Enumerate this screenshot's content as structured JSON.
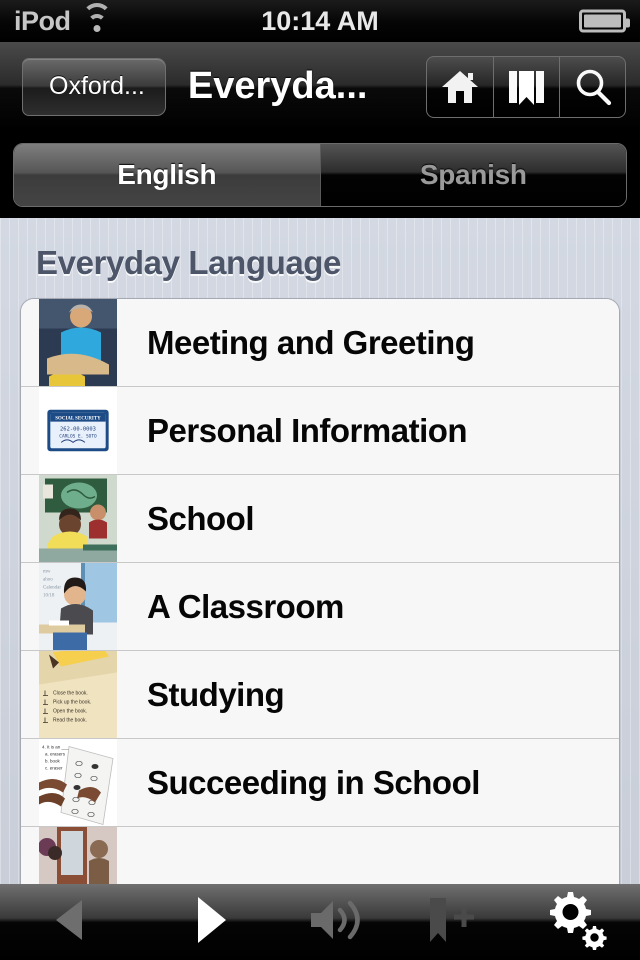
{
  "status_bar": {
    "carrier": "iPod",
    "wifi_icon": "wifi-icon",
    "time": "10:14 AM",
    "battery_icon": "battery-icon"
  },
  "nav_bar": {
    "back_label": "Oxford...",
    "title": "Everyda...",
    "buttons": [
      {
        "name": "home-button",
        "icon": "home-icon"
      },
      {
        "name": "bookmarks-button",
        "icon": "bookmarks-icon"
      },
      {
        "name": "search-button",
        "icon": "search-icon"
      }
    ]
  },
  "segmented_control": {
    "selected": "English",
    "segments": [
      {
        "label": "English",
        "selected": true
      },
      {
        "label": "Spanish",
        "selected": false
      }
    ]
  },
  "main": {
    "section_title": "Everyday Language",
    "rows": [
      {
        "label": "Meeting and Greeting",
        "thumb": "people-shaking-hands-photo"
      },
      {
        "label": "Personal Information",
        "thumb": "social-security-card-photo"
      },
      {
        "label": "School",
        "thumb": "student-raising-hand-photo"
      },
      {
        "label": "A Classroom",
        "thumb": "student-at-desk-photo"
      },
      {
        "label": "Studying",
        "thumb": "pencil-and-book-instructions-photo"
      },
      {
        "label": "Succeeding in School",
        "thumb": "multiple-choice-test-photo"
      },
      {
        "label": "",
        "thumb": "classroom-doorway-photo"
      }
    ]
  },
  "toolbar": {
    "buttons": [
      {
        "name": "previous-button",
        "icon": "previous-triangle-icon"
      },
      {
        "name": "play-button",
        "icon": "play-triangle-icon"
      },
      {
        "name": "audio-button",
        "icon": "speaker-volume-icon"
      },
      {
        "name": "add-bookmark-button",
        "icon": "bookmark-plus-icon"
      },
      {
        "name": "settings-button",
        "icon": "gears-icon"
      }
    ]
  },
  "colors": {
    "status_bar_bg": "#000000",
    "nav_bar_bg": "#2b2b2b",
    "content_bg": "#cdd2dd",
    "section_title": "#4d5569",
    "row_bg": "#f7f7f7",
    "row_text": "#060606",
    "segment_selected_text": "#ffffff",
    "segment_unselected_text": "#9a9a9a"
  }
}
